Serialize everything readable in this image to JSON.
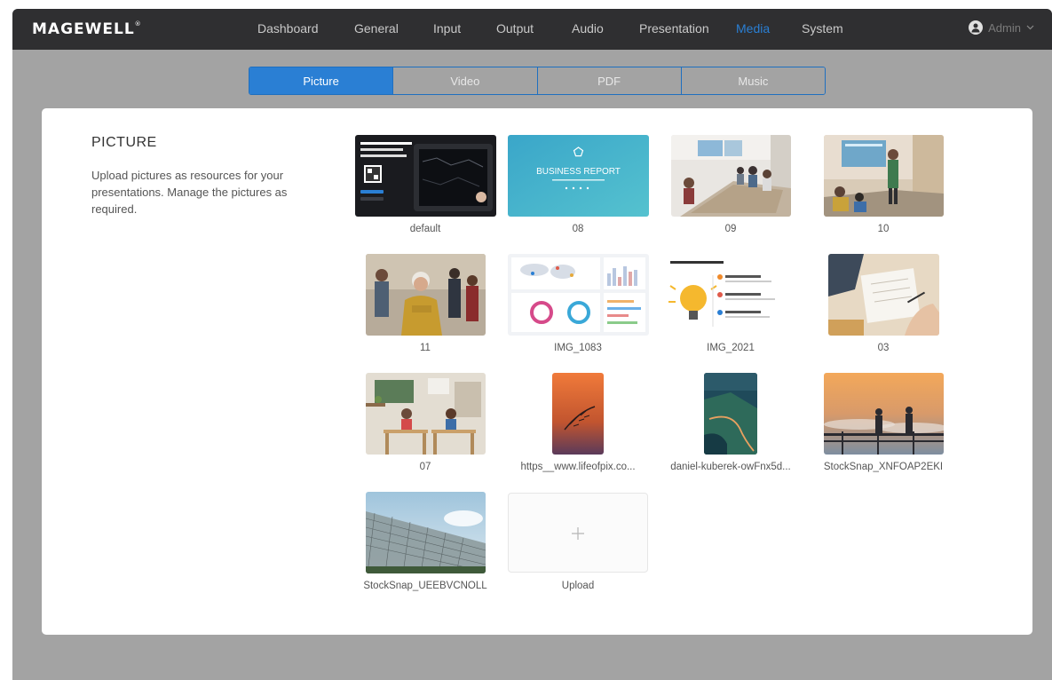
{
  "app": {
    "logo": "MAGEWELL",
    "logo_mark": "®"
  },
  "nav": {
    "items": [
      {
        "label": "Dashboard",
        "active": false
      },
      {
        "label": "General",
        "active": false
      },
      {
        "label": "Input",
        "active": false
      },
      {
        "label": "Output",
        "active": false
      },
      {
        "label": "Audio",
        "active": false
      },
      {
        "label": "Presentation",
        "active": false
      },
      {
        "label": "Media",
        "active": true
      },
      {
        "label": "System",
        "active": false
      }
    ],
    "user": {
      "name": "Admin",
      "icon": "user-icon",
      "dropdown_icon": "chevron-down-icon"
    },
    "active_color": "#2a7fd4"
  },
  "media_tabs": [
    {
      "label": "Picture",
      "active": true
    },
    {
      "label": "Video",
      "active": false
    },
    {
      "label": "PDF",
      "active": false
    },
    {
      "label": "Music",
      "active": false
    }
  ],
  "section": {
    "title": "PICTURE",
    "description": "Upload pictures as resources for your presentations. Manage the pictures as required."
  },
  "pictures": [
    {
      "name": "default",
      "scene": "dark-tablet"
    },
    {
      "name": "08",
      "scene": "business-report",
      "thumb_text": "BUSINESS REPORT"
    },
    {
      "name": "09",
      "scene": "meeting-room"
    },
    {
      "name": "10",
      "scene": "presentation-room"
    },
    {
      "name": "11",
      "scene": "people-group"
    },
    {
      "name": "IMG_1083",
      "scene": "dashboard"
    },
    {
      "name": "IMG_2021",
      "scene": "infographic"
    },
    {
      "name": "03",
      "scene": "desk-writing"
    },
    {
      "name": "07",
      "scene": "classroom"
    },
    {
      "name": "https__www.lifeofpix.co...",
      "scene": "sunset-feather"
    },
    {
      "name": "daniel-kuberek-owFnx5d...",
      "scene": "coast-road"
    },
    {
      "name": "StockSnap_XNFOAP2EKI",
      "scene": "sunrise-railing"
    },
    {
      "name": "StockSnap_UEEBVCNOLL",
      "scene": "fence-sky"
    }
  ],
  "upload": {
    "label": "Upload",
    "icon": "plus-icon"
  }
}
